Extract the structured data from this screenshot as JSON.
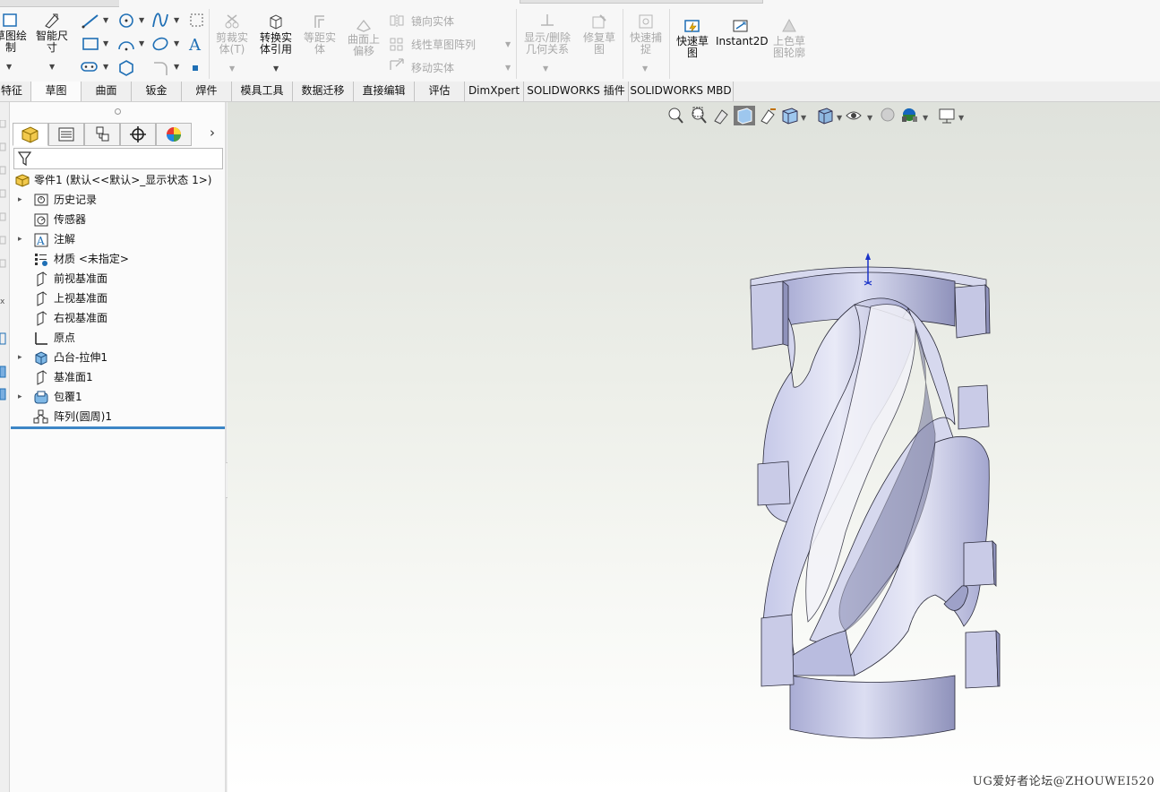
{
  "ribbon": {
    "sketch_draw_label": "草图绘\n制",
    "smart_dim_label": "智能尺\n寸",
    "trim_label": "剪裁实\n体(T)",
    "convert_label": "转换实\n体引用",
    "offset_label": "等距实\n体",
    "surface_offset_label": "曲面上\n偏移",
    "mirror_label": "镜向实体",
    "linear_pattern_label": "线性草图阵列",
    "move_label": "移动实体",
    "show_delete_label": "显示/删除\n几何关系",
    "repair_label": "修复草\n图",
    "quick_snap_label": "快速捕\n捉",
    "rapid_sketch_label": "快速草\n图",
    "instant2d_label": "Instant2D",
    "shaded_label": "上色草\n图轮廓"
  },
  "tabs": [
    {
      "label": "特征",
      "active": false
    },
    {
      "label": "草图",
      "active": true
    },
    {
      "label": "曲面",
      "active": false
    },
    {
      "label": "钣金",
      "active": false
    },
    {
      "label": "焊件",
      "active": false
    },
    {
      "label": "模具工具",
      "active": false
    },
    {
      "label": "数据迁移",
      "active": false
    },
    {
      "label": "直接编辑",
      "active": false
    },
    {
      "label": "评估",
      "active": false
    },
    {
      "label": "DimXpert",
      "active": false
    },
    {
      "label": "SOLIDWORKS 插件",
      "active": false
    },
    {
      "label": "SOLIDWORKS MBD",
      "active": false
    }
  ],
  "tree": {
    "root": "零件1  (默认<<默认>_显示状态 1>)",
    "items": [
      {
        "label": "历史记录",
        "expandable": true,
        "icon": "history-icon"
      },
      {
        "label": "传感器",
        "expandable": false,
        "icon": "sensor-icon"
      },
      {
        "label": "注解",
        "expandable": true,
        "icon": "annotation-icon"
      },
      {
        "label": "材质 <未指定>",
        "expandable": false,
        "icon": "material-icon"
      },
      {
        "label": "前视基准面",
        "expandable": false,
        "icon": "plane-icon"
      },
      {
        "label": "上视基准面",
        "expandable": false,
        "icon": "plane-icon"
      },
      {
        "label": "右视基准面",
        "expandable": false,
        "icon": "plane-icon"
      },
      {
        "label": "原点",
        "expandable": false,
        "icon": "origin-icon"
      },
      {
        "label": "凸台-拉伸1",
        "expandable": true,
        "icon": "extrude-icon"
      },
      {
        "label": "基准面1",
        "expandable": false,
        "icon": "plane-icon"
      },
      {
        "label": "包覆1",
        "expandable": true,
        "icon": "wrap-icon"
      },
      {
        "label": "阵列(圆周)1",
        "expandable": false,
        "icon": "circular-pattern-icon"
      }
    ]
  },
  "watermark": "UG爱好者论坛@ZHOUWEI520"
}
